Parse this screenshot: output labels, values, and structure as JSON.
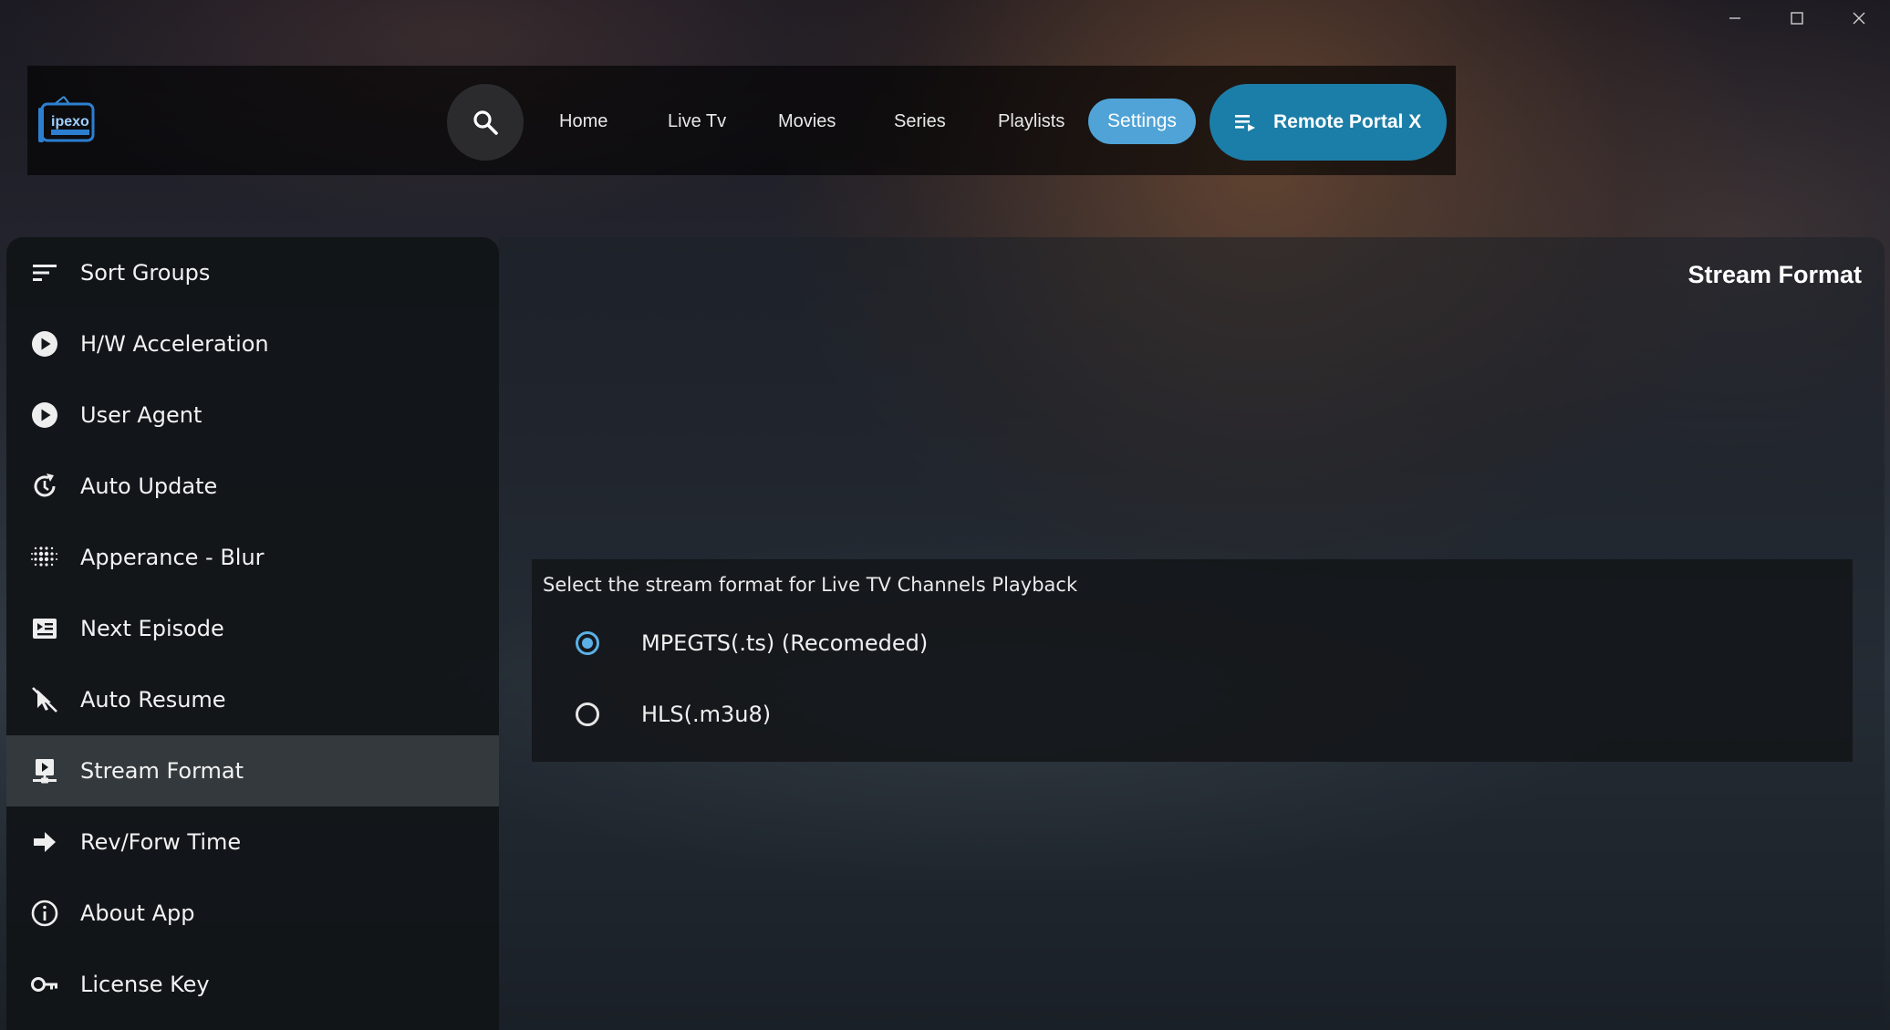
{
  "window": {
    "controls": [
      "minimize-icon",
      "maximize-icon",
      "close-icon"
    ]
  },
  "topbar": {
    "logo_text": "ipexo",
    "search_icon": "search-icon",
    "nav": [
      {
        "label": "Home"
      },
      {
        "label": "Live Tv"
      },
      {
        "label": "Movies"
      },
      {
        "label": "Series"
      },
      {
        "label": "Playlists"
      }
    ],
    "active_nav": "Settings",
    "portal_button": {
      "label": "Remote Portal X",
      "icon": "playlist-icon"
    },
    "accent_color": "#4fa3d6",
    "portal_color": "#1b7ea8"
  },
  "sidebar": {
    "items": [
      {
        "label": "Sort Groups",
        "icon": "sort-icon"
      },
      {
        "label": "H/W Acceleration",
        "icon": "play-circle-icon"
      },
      {
        "label": "User Agent",
        "icon": "play-circle-icon"
      },
      {
        "label": "Auto Update",
        "icon": "update-icon"
      },
      {
        "label": "Apperance - Blur",
        "icon": "blur-icon"
      },
      {
        "label": "Next Episode",
        "icon": "next-episode-icon"
      },
      {
        "label": "Auto Resume",
        "icon": "cursor-off-icon"
      },
      {
        "label": "Stream Format",
        "icon": "stream-icon",
        "active": true
      },
      {
        "label": "Rev/Forw Time",
        "icon": "arrow-right-icon"
      },
      {
        "label": "About App",
        "icon": "info-icon"
      },
      {
        "label": "License Key",
        "icon": "key-icon"
      }
    ]
  },
  "main": {
    "title": "Stream Format",
    "description": "Select the stream format for Live TV Channels Playback",
    "options": [
      {
        "label": "MPEGTS(.ts) (Recomeded)",
        "selected": true
      },
      {
        "label": "HLS(.m3u8)",
        "selected": false
      }
    ],
    "selected_color": "#5bb0e6"
  }
}
